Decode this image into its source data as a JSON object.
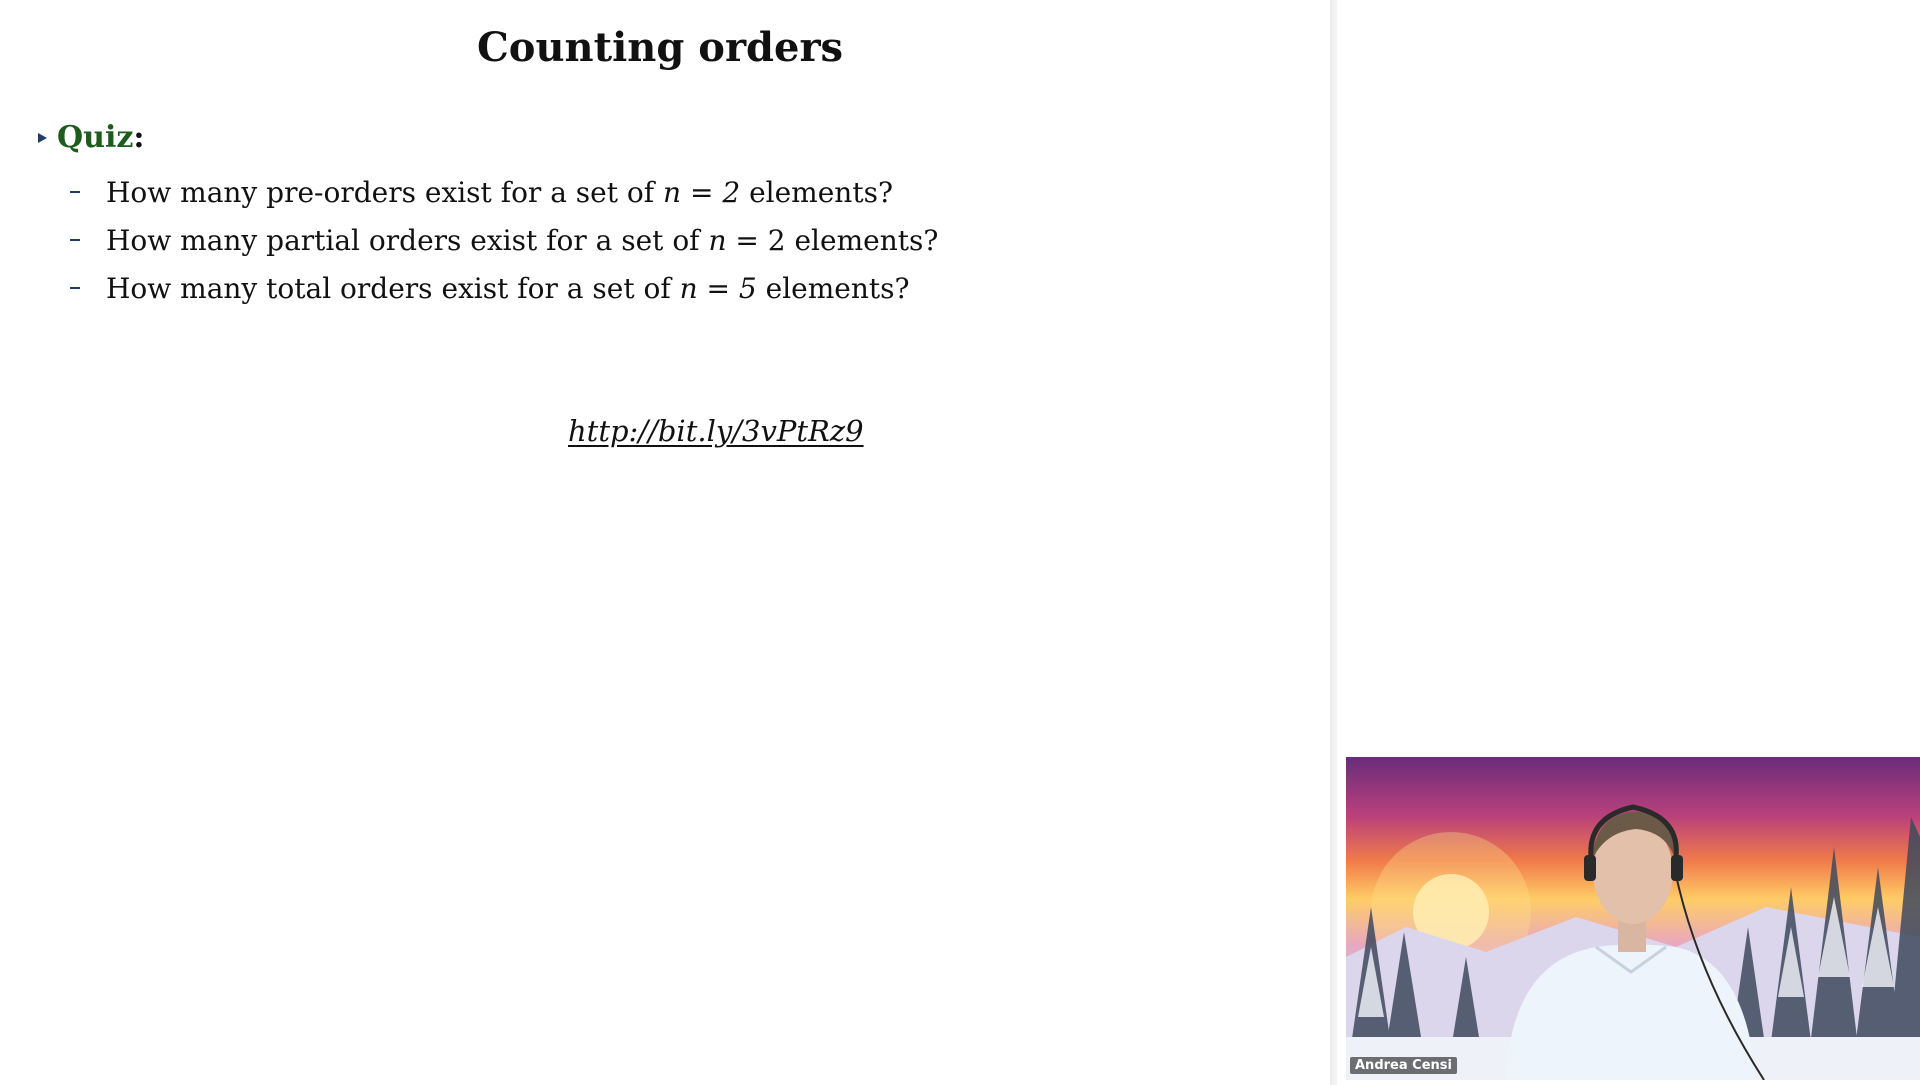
{
  "slide": {
    "title": "Counting orders",
    "quiz_label": "Quiz",
    "quiz_colon": ":",
    "questions": [
      {
        "before": "How many pre-orders exist for a set of ",
        "var": "n",
        "eq": " = ",
        "num": "2",
        "after": " elements?"
      },
      {
        "before": "How many partial orders exist for a set of ",
        "var": "n",
        "eq": " = ",
        "num": "2",
        "after": " elements?"
      },
      {
        "before": "How many total orders exist for a set of ",
        "var": "n",
        "eq": " = ",
        "num": "5",
        "after": " elements?"
      }
    ],
    "link": "http://bit.ly/3vPtRz9"
  },
  "webcam": {
    "participant_name": "Andrea Censi",
    "background_scene": "winter-sunset-forest"
  },
  "colors": {
    "quiz_accent": "#1e5c1e",
    "bullet": "#1f3d6b",
    "text": "#111111"
  }
}
